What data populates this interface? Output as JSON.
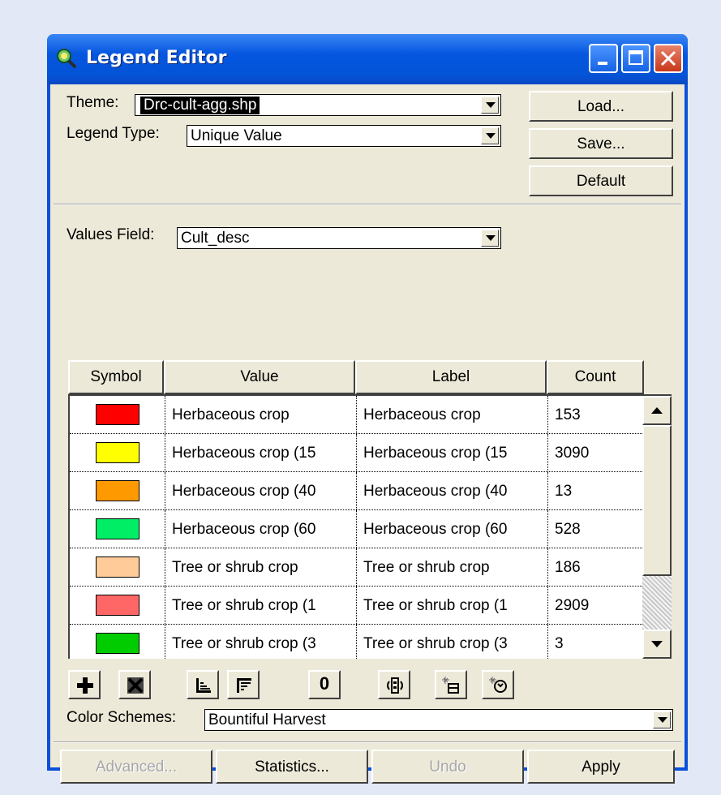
{
  "window": {
    "title": "Legend Editor"
  },
  "theme": {
    "label": "Theme:",
    "value": "Drc-cult-agg.shp"
  },
  "legend_type": {
    "label": "Legend Type:",
    "value": "Unique Value"
  },
  "buttons": {
    "load": "Load...",
    "save": "Save...",
    "default": "Default"
  },
  "values_field": {
    "label": "Values Field:",
    "value": "Cult_desc"
  },
  "table": {
    "headers": [
      "Symbol",
      "Value",
      "Label",
      "Count"
    ],
    "rows": [
      {
        "color": "#ff0000",
        "value": "Herbaceous crop",
        "label": "Herbaceous crop",
        "count": "153"
      },
      {
        "color": "#ffff00",
        "value": "Herbaceous crop (15",
        "label": "Herbaceous crop (15",
        "count": "3090"
      },
      {
        "color": "#ff9900",
        "value": "Herbaceous crop (40",
        "label": "Herbaceous crop (40",
        "count": "13"
      },
      {
        "color": "#00ee66",
        "value": "Herbaceous crop (60",
        "label": "Herbaceous crop (60",
        "count": "528"
      },
      {
        "color": "#ffcc99",
        "value": "Tree or shrub crop",
        "label": "Tree or shrub crop",
        "count": "186"
      },
      {
        "color": "#ff6666",
        "value": "Tree or shrub crop (1",
        "label": "Tree or shrub crop (1",
        "count": "2909"
      },
      {
        "color": "#00cc00",
        "value": "Tree or shrub crop (3",
        "label": "Tree or shrub crop (3",
        "count": "3"
      }
    ]
  },
  "toolbar": {
    "add_icon": "plus-icon",
    "delete_icon": "delete-icon",
    "sort_ascending_icon": "sort-ascending-icon",
    "sort_descending_icon": "sort-descending-icon",
    "null_value_label": "0",
    "reverse_icon": "reverse-colors-icon",
    "flip_icon": "flip-symbols-icon",
    "randomize_icon": "randomize-colors-icon"
  },
  "color_schemes": {
    "label": "Color Schemes:",
    "value": "Bountiful Harvest"
  },
  "bottom_buttons": {
    "advanced": "Advanced...",
    "statistics": "Statistics...",
    "undo": "Undo",
    "apply": "Apply"
  }
}
